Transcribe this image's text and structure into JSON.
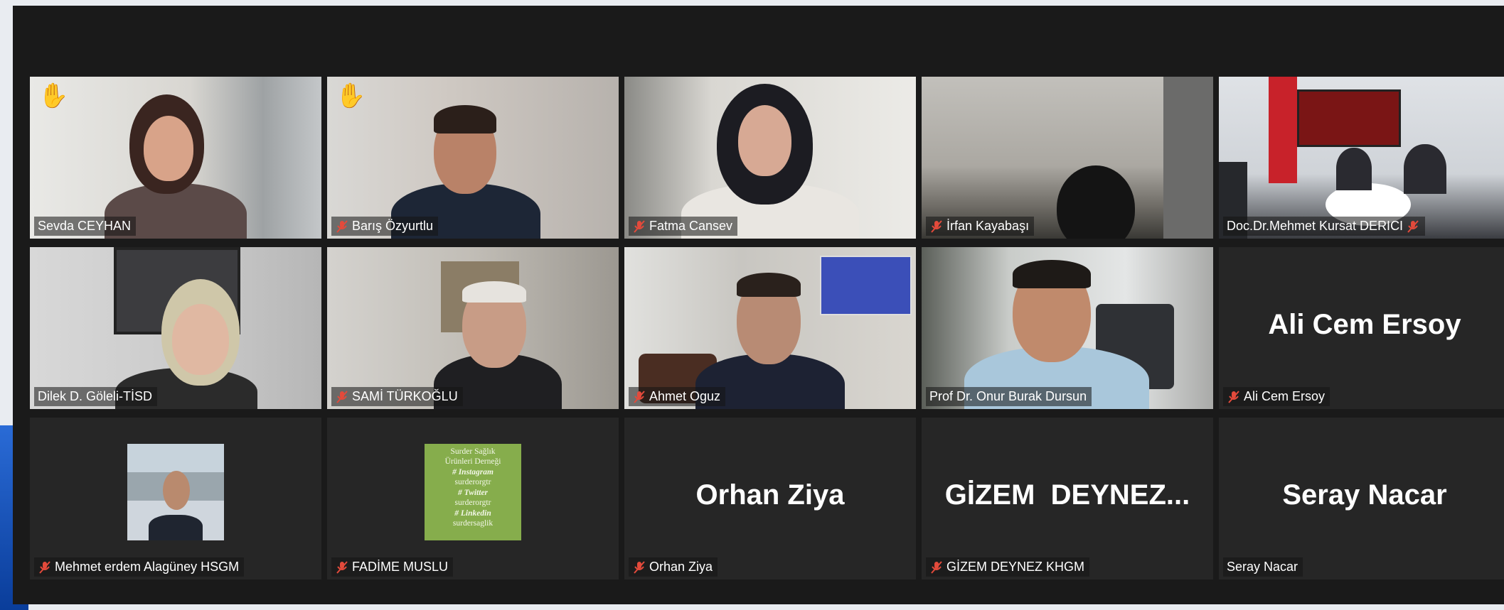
{
  "meeting": {
    "participants": [
      {
        "name": "Sevda CEYHAN",
        "hand_raised": true,
        "muted": false,
        "active": true
      },
      {
        "name": "Barış Özyurtlu",
        "hand_raised": true,
        "muted": true
      },
      {
        "name": "Fatma Cansev",
        "muted": true
      },
      {
        "name": "İrfan Kayabaşı",
        "muted": true
      },
      {
        "name": "Doc.Dr.Mehmet Kursat DERICI",
        "muted": true
      },
      {
        "name": "Dilek D. Göleli-TİSD",
        "muted": false
      },
      {
        "name": "SAMİ TÜRKOĞLU",
        "muted": true
      },
      {
        "name": "Ahmet Oguz",
        "muted": true
      },
      {
        "name": "Prof Dr. Onur Burak Dursun",
        "muted": false
      },
      {
        "name": "Ali Cem Ersoy",
        "display": "Ali Cem Ersoy",
        "muted": true
      },
      {
        "name": "Mehmet erdem Alagüney HSGM",
        "muted": true
      },
      {
        "name": "FADİME MUSLU",
        "muted": true
      },
      {
        "name": "Orhan Ziya",
        "display": "Orhan Ziya",
        "muted": true
      },
      {
        "name": "GİZEM DEYNEZ KHGM",
        "display": "GİZEM  DEYNEZ...",
        "muted": true
      },
      {
        "name": "Seray Nacar",
        "display": "Seray Nacar",
        "muted": false
      }
    ],
    "fadime_card_lines": [
      "Surder Sağlık",
      "Ürünleri Derneği",
      "# Instagram",
      "surderorgtr",
      "# Twitter",
      "surderorgtr",
      "# Linkedin",
      "surdersaglik"
    ],
    "colors": {
      "active_border": "#d8e63a",
      "muted_icon": "#e34a3b",
      "hand": "#f5b400"
    }
  }
}
